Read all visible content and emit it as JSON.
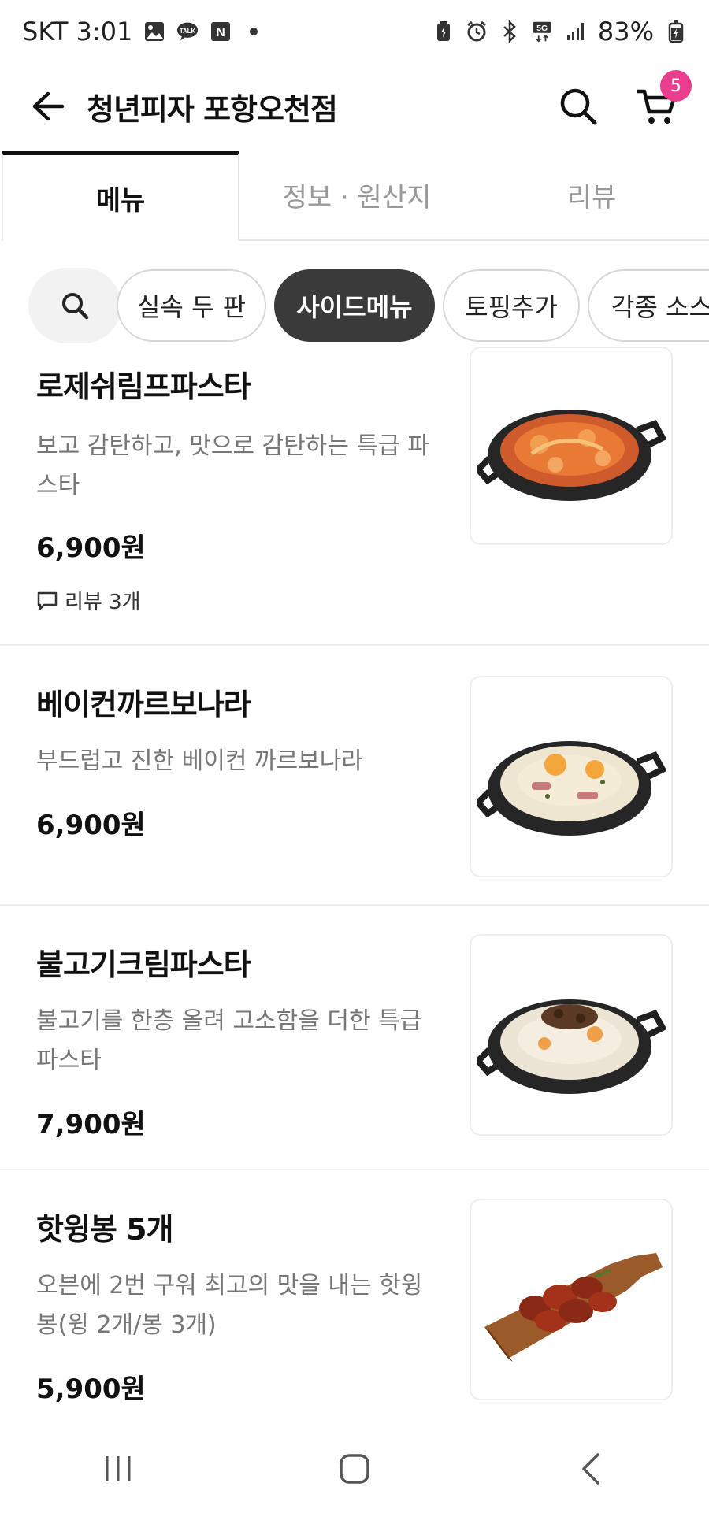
{
  "status_bar": {
    "carrier_time": "SKT 3:01",
    "talk_label": "TALK",
    "n_label": "N",
    "network": "5G",
    "battery": "83%"
  },
  "header": {
    "store_name": "청년피자 포항오천점",
    "cart_count": "5"
  },
  "tabs": [
    {
      "label": "메뉴",
      "active": true
    },
    {
      "label": "정보 · 원산지",
      "active": false
    },
    {
      "label": "리뷰",
      "active": false
    }
  ],
  "categories": [
    {
      "label": "실속 두 판",
      "selected": false
    },
    {
      "label": "사이드메뉴",
      "selected": true
    },
    {
      "label": "토핑추가",
      "selected": false
    },
    {
      "label": "각종 소스",
      "selected": false
    }
  ],
  "menu_items": [
    {
      "name": "로제쉬림프파스타",
      "description": "보고 감탄하고, 맛으로 감탄하는 특급 파스타",
      "price": "6,900원",
      "review": "리뷰 3개",
      "image": "rose-shrimp-pasta-pan"
    },
    {
      "name": "베이컨까르보나라",
      "description": "부드럽고 진한 베이컨 까르보나라",
      "price": "6,900원",
      "image": "bacon-carbonara-pan"
    },
    {
      "name": "불고기크림파스타",
      "description": "불고기를 한층 올려 고소함을 더한 특급 파스타",
      "price": "7,900원",
      "image": "bulgogi-cream-pasta-pan"
    },
    {
      "name": "핫윙봉 5개",
      "description": "오븐에 2번 구워 최고의 맛을 내는 핫윙봉(윙 2개/봉 3개)",
      "price": "5,900원",
      "image": "hot-wings-board"
    }
  ],
  "colors": {
    "accent_badge": "#ea3d8d",
    "selected_chip": "#3a3a3a",
    "muted_text": "#777777"
  }
}
